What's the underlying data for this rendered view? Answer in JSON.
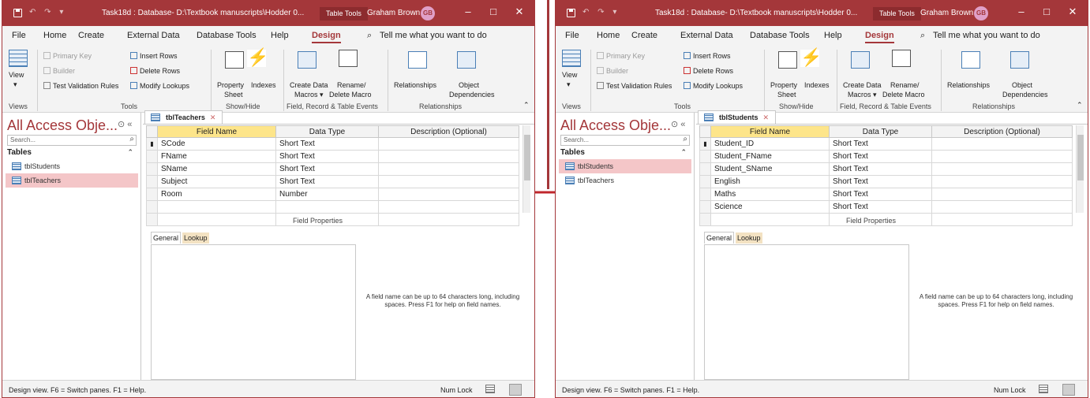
{
  "windows": [
    {
      "title": "Task18d : Database- D:\\Textbook manuscripts\\Hodder 0...",
      "table_tools": "Table Tools",
      "user": "Graham Brown",
      "avatar": "GB",
      "menu": [
        "File",
        "Home",
        "Create",
        "External Data",
        "Database Tools",
        "Help",
        "Design",
        "Tell me what you want to do"
      ],
      "ribbon": {
        "view": "View",
        "primary_key": "Primary Key",
        "builder": "Builder",
        "test_validation": "Test Validation Rules",
        "insert_rows": "Insert Rows",
        "delete_rows": "Delete Rows",
        "modify_lookups": "Modify Lookups",
        "property_sheet_1": "Property",
        "property_sheet_2": "Sheet",
        "indexes": "Indexes",
        "create_data_macros_1": "Create Data",
        "create_data_macros_2": "Macros",
        "rename_delete_1": "Rename/",
        "rename_delete_2": "Delete Macro",
        "relationships": "Relationships",
        "object_dep_1": "Object",
        "object_dep_2": "Dependencies",
        "groups": [
          "Views",
          "Tools",
          "Show/Hide",
          "Field, Record & Table Events",
          "Relationships"
        ]
      },
      "nav": {
        "header": "All Access Obje...",
        "search": "Search...",
        "section": "Tables",
        "items": [
          "tblStudents",
          "tblTeachers"
        ],
        "selected": "tblTeachers"
      },
      "tab": "tblTeachers",
      "grid": {
        "headers": [
          "Field Name",
          "Data Type",
          "Description (Optional)"
        ],
        "rows": [
          [
            "SCode",
            "Short Text"
          ],
          [
            "FName",
            "Short Text"
          ],
          [
            "SName",
            "Short Text"
          ],
          [
            "Subject",
            "Short Text"
          ],
          [
            "Room",
            "Number"
          ]
        ]
      },
      "field_properties": "Field Properties",
      "fp_tabs": [
        "General",
        "Lookup"
      ],
      "help_text": "A field name can be up to 64 characters long, including spaces. Press F1 for help on field names.",
      "status": "Design view.  F6 = Switch panes.  F1 = Help.",
      "num_lock": "Num Lock"
    },
    {
      "title": "Task18d : Database- D:\\Textbook manuscripts\\Hodder 0...",
      "table_tools": "Table Tools",
      "user": "Graham Brown",
      "avatar": "GB",
      "menu": [
        "File",
        "Home",
        "Create",
        "External Data",
        "Database Tools",
        "Help",
        "Design",
        "Tell me what you want to do"
      ],
      "ribbon": {
        "view": "View",
        "primary_key": "Primary Key",
        "builder": "Builder",
        "test_validation": "Test Validation Rules",
        "insert_rows": "Insert Rows",
        "delete_rows": "Delete Rows",
        "modify_lookups": "Modify Lookups",
        "property_sheet_1": "Property",
        "property_sheet_2": "Sheet",
        "indexes": "Indexes",
        "create_data_macros_1": "Create Data",
        "create_data_macros_2": "Macros",
        "rename_delete_1": "Rename/",
        "rename_delete_2": "Delete Macro",
        "relationships": "Relationships",
        "object_dep_1": "Object",
        "object_dep_2": "Dependencies",
        "groups": [
          "Views",
          "Tools",
          "Show/Hide",
          "Field, Record & Table Events",
          "Relationships"
        ]
      },
      "nav": {
        "header": "All Access Obje...",
        "search": "Search...",
        "section": "Tables",
        "items": [
          "tblStudents",
          "tblTeachers"
        ],
        "selected": "tblStudents"
      },
      "tab": "tblStudents",
      "grid": {
        "headers": [
          "Field Name",
          "Data Type",
          "Description (Optional)"
        ],
        "rows": [
          [
            "Student_ID",
            "Short Text"
          ],
          [
            "Student_FName",
            "Short Text"
          ],
          [
            "Student_SName",
            "Short Text"
          ],
          [
            "English",
            "Short Text"
          ],
          [
            "Maths",
            "Short Text"
          ],
          [
            "Science",
            "Short Text"
          ]
        ]
      },
      "field_properties": "Field Properties",
      "fp_tabs": [
        "General",
        "Lookup"
      ],
      "help_text": "A field name can be up to 64 characters long, including spaces. Press F1 for help on field names.",
      "status": "Design view.  F6 = Switch panes.  F1 = Help.",
      "num_lock": "Num Lock"
    }
  ],
  "colors": {
    "accent": "#a4373a",
    "selected_row": "#f4c6c8",
    "field_header": "#fde58a"
  }
}
